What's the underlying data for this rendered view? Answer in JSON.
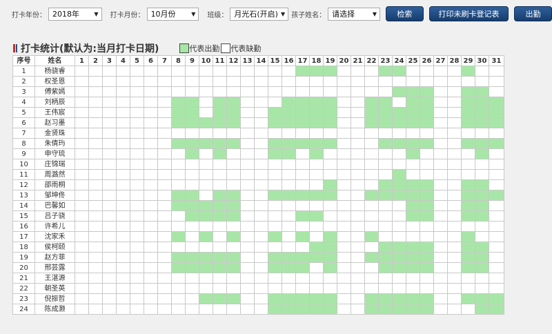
{
  "colors": {
    "present": "#a8e6a8",
    "absent": "#ffffff",
    "button": "#1f4a82"
  },
  "filters": {
    "year_label": "打卡年份：",
    "year_value": "2018年",
    "month_label": "打卡月份：",
    "month_value": "10月份",
    "class_label": "班级：",
    "class_value": "月光石(开启)",
    "child_label": "孩子姓名：",
    "child_value": "请选择"
  },
  "buttons": {
    "search": "检索",
    "print": "打印未刷卡登记表",
    "export": "出勤"
  },
  "section": {
    "title": "打卡统计(默认为:当月打卡日期)",
    "legend_present": "代表出勤",
    "legend_absent": "代表缺勤"
  },
  "table": {
    "header_index": "序号",
    "header_name": "姓名",
    "days": [
      "1",
      "2",
      "3",
      "4",
      "5",
      "6",
      "7",
      "8",
      "9",
      "10",
      "11",
      "12",
      "13",
      "14",
      "15",
      "16",
      "17",
      "18",
      "19",
      "20",
      "21",
      "22",
      "23",
      "24",
      "25",
      "26",
      "27",
      "28",
      "29",
      "30",
      "31"
    ],
    "rows": [
      {
        "no": "1",
        "name": "杨骁睿",
        "present": [
          17,
          18,
          19,
          23,
          24,
          29
        ]
      },
      {
        "no": "2",
        "name": "权圣恩",
        "present": []
      },
      {
        "no": "3",
        "name": "傅紫嫣",
        "present": [
          24,
          25,
          26,
          29,
          30
        ]
      },
      {
        "no": "4",
        "name": "刘柄辰",
        "present": [
          8,
          9,
          11,
          12,
          16,
          17,
          18,
          19,
          22,
          23,
          25,
          26,
          29,
          30,
          31
        ]
      },
      {
        "no": "5",
        "name": "王伟宸",
        "present": [
          8,
          9,
          11,
          12,
          15,
          16,
          17,
          18,
          19,
          22,
          23,
          24,
          25,
          26,
          29,
          30,
          31
        ]
      },
      {
        "no": "6",
        "name": "赵习墨",
        "present": [
          8,
          9,
          10,
          11,
          12,
          15,
          16,
          17,
          18,
          19,
          22,
          23,
          24,
          25,
          26,
          29,
          30,
          31
        ]
      },
      {
        "no": "7",
        "name": "金贤珠",
        "present": []
      },
      {
        "no": "8",
        "name": "朱倩玙",
        "present": [
          8,
          9,
          10,
          11,
          12,
          15,
          16,
          17,
          18,
          19,
          23,
          24,
          25,
          26,
          29,
          30,
          31
        ]
      },
      {
        "no": "9",
        "name": "申守琉",
        "present": [
          9,
          11,
          15,
          16,
          18,
          25,
          30
        ]
      },
      {
        "no": "10",
        "name": "庄锦瑞",
        "present": []
      },
      {
        "no": "11",
        "name": "周潞然",
        "present": [
          24
        ]
      },
      {
        "no": "12",
        "name": "邵雨桐",
        "present": [
          19,
          23,
          24,
          25,
          26,
          29,
          30
        ]
      },
      {
        "no": "13",
        "name": "邹坤佟",
        "present": [
          8,
          9,
          11,
          12,
          15,
          16,
          17,
          18,
          19,
          22,
          23,
          24,
          25,
          26,
          29,
          30,
          31
        ]
      },
      {
        "no": "14",
        "name": "巴馨如",
        "present": [
          8,
          9,
          10,
          11,
          12,
          25,
          26,
          29,
          30
        ]
      },
      {
        "no": "15",
        "name": "吕子骁",
        "present": [
          9,
          10,
          11,
          12,
          17,
          18,
          25,
          26,
          29,
          30
        ]
      },
      {
        "no": "16",
        "name": "许希儿",
        "present": []
      },
      {
        "no": "17",
        "name": "沈家禾",
        "present": [
          8,
          10,
          12,
          15,
          17,
          19,
          22,
          29
        ]
      },
      {
        "no": "18",
        "name": "侯柯颐",
        "present": [
          18,
          19,
          23,
          24,
          25,
          26,
          29,
          30
        ]
      },
      {
        "no": "19",
        "name": "赵方菲",
        "present": [
          8,
          9,
          10,
          11,
          12,
          15,
          16,
          17,
          18,
          19,
          22,
          23,
          24,
          25,
          26,
          29,
          30
        ]
      },
      {
        "no": "20",
        "name": "邢芸露",
        "present": [
          8,
          9,
          10,
          11,
          12,
          15,
          16,
          17,
          19,
          23,
          24,
          25,
          26,
          29,
          30
        ]
      },
      {
        "no": "21",
        "name": "王湛源",
        "present": []
      },
      {
        "no": "22",
        "name": "朝圣英",
        "present": []
      },
      {
        "no": "23",
        "name": "倪振哲",
        "present": [
          10,
          11,
          12,
          15,
          16,
          17,
          18,
          19,
          22,
          23,
          24,
          25,
          26,
          29,
          30,
          31
        ]
      },
      {
        "no": "24",
        "name": "陈成灏",
        "present": [
          15,
          16,
          17,
          18,
          19,
          22,
          23,
          24,
          25,
          26,
          30,
          31
        ]
      }
    ]
  }
}
